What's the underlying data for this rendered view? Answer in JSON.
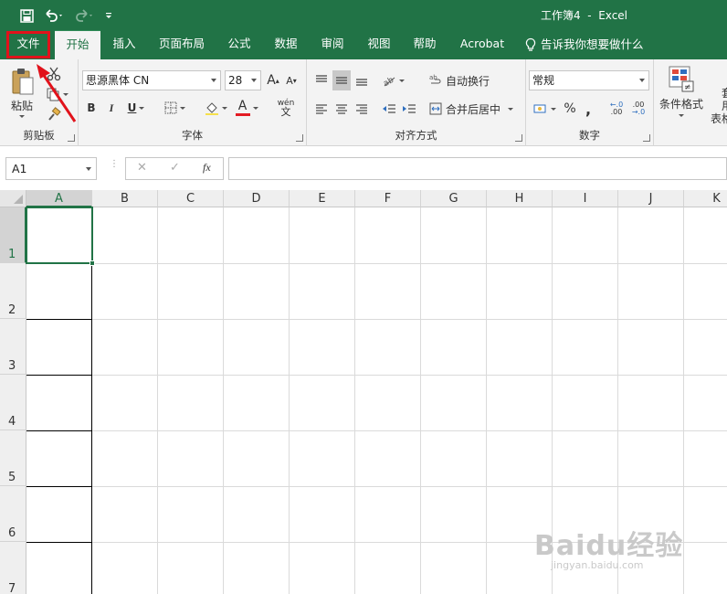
{
  "window": {
    "title": "工作簿4  -  Excel"
  },
  "quick_access": {
    "save_icon": "save-icon",
    "undo_icon": "undo-icon",
    "redo_icon": "redo-icon",
    "customize_icon": "customize-qat-icon"
  },
  "tabs": [
    {
      "label": "文件"
    },
    {
      "label": "开始"
    },
    {
      "label": "插入"
    },
    {
      "label": "页面布局"
    },
    {
      "label": "公式"
    },
    {
      "label": "数据"
    },
    {
      "label": "审阅"
    },
    {
      "label": "视图"
    },
    {
      "label": "帮助"
    },
    {
      "label": "Acrobat"
    },
    {
      "label": "告诉我你想要做什么"
    }
  ],
  "ribbon": {
    "clipboard": {
      "label": "剪贴板",
      "paste_label": "粘贴"
    },
    "font": {
      "label": "字体",
      "font_name": "思源黑体 CN",
      "font_size": "28",
      "bold": "B",
      "italic": "I",
      "underline": "U",
      "grow": "A",
      "shrink": "A",
      "phonetic": "wén",
      "font_color_letter": "A",
      "font_color": "#e31b23"
    },
    "alignment": {
      "label": "对齐方式",
      "wrap_text": "自动换行",
      "merge_center": "合并后居中"
    },
    "number": {
      "label": "数字",
      "format": "常规",
      "percent": "%",
      "comma": ",",
      "inc_decimal": ".00",
      "dec_decimal": ".00"
    },
    "styles": {
      "conditional": "条件格式",
      "table_partial": "套用",
      "table_partial2": "表格"
    }
  },
  "formula_bar": {
    "name_box": "A1",
    "cancel": "✕",
    "enter": "✓",
    "fx": "fx",
    "value": ""
  },
  "grid": {
    "columns": [
      "A",
      "B",
      "C",
      "D",
      "E",
      "F",
      "G",
      "H",
      "I",
      "J",
      "K"
    ],
    "rows": [
      "1",
      "2",
      "3",
      "4",
      "5",
      "6",
      "7"
    ],
    "selected_cell": "A1"
  },
  "watermark": {
    "brand": "Baidu经验",
    "url": "jingyan.baidu.com"
  },
  "colors": {
    "excel_green": "#217346",
    "highlight_red": "#e1121b"
  }
}
